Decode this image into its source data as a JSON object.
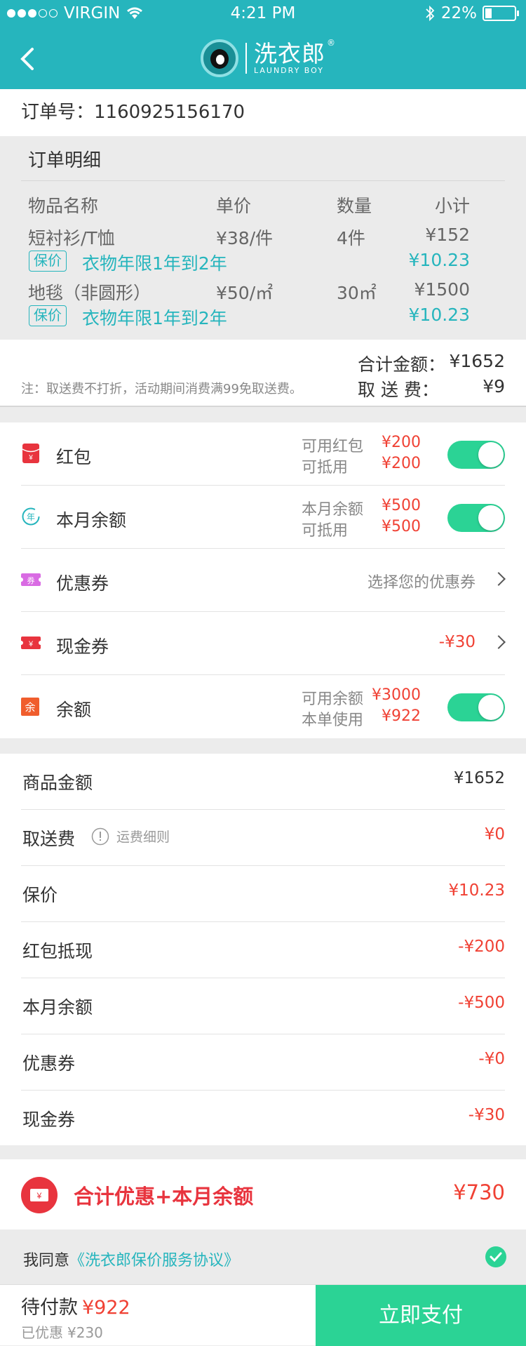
{
  "status_bar": {
    "carrier": "VIRGIN",
    "time": "4:21 PM",
    "battery": "22%"
  },
  "header": {
    "brand_cn": "洗衣郎",
    "brand_en": "LAUNDRY BOY",
    "brand_mark": "®"
  },
  "order": {
    "number_label": "订单号：",
    "number": "1160925156170"
  },
  "detail": {
    "title": "订单明细",
    "columns": [
      "物品名称",
      "单价",
      "数量",
      "小计"
    ],
    "items": [
      {
        "name": "短衬衫/T恤",
        "price": "¥38/件",
        "qty": "4件",
        "subtotal": "¥152",
        "tag": "保价",
        "tag_text": "衣物年限1年到2年",
        "insured": "¥10.23"
      },
      {
        "name": "地毯（非圆形）",
        "price": "¥50/㎡",
        "qty": "30㎡",
        "subtotal": "¥1500",
        "tag": "保价",
        "tag_text": "衣物年限1年到2年",
        "insured": "¥10.23"
      }
    ]
  },
  "totals": {
    "note": "注：取送费不打折，活动期间消费满99免取送费。",
    "sum_label": "合计金额：",
    "sum_value": "¥1652",
    "delivery_label": "取 送 费：",
    "delivery_value": "¥9"
  },
  "options": {
    "hongbao": {
      "label": "红包",
      "sub1": "可用红包",
      "val1": "¥200",
      "sub2": "可抵用",
      "val2": "¥200",
      "icon": "red-envelope-icon",
      "toggle": true
    },
    "monthly": {
      "label": "本月余额",
      "sub1": "本月余额",
      "val1": "¥500",
      "sub2": "可抵用",
      "val2": "¥500",
      "icon": "monthly-balance-icon",
      "toggle": true
    },
    "coupon": {
      "label": "优惠券",
      "placeholder": "选择您的优惠券",
      "icon": "coupon-icon"
    },
    "cash": {
      "label": "现金券",
      "value": "-¥30",
      "icon": "cash-coupon-icon"
    },
    "balance": {
      "label": "余额",
      "sub1": "可用余额",
      "val1": "¥3000",
      "sub2": "本单使用",
      "val2": "¥922",
      "icon": "balance-icon",
      "toggle": true
    }
  },
  "summary": {
    "goods_label": "商品金额",
    "goods_value": "¥1652",
    "delivery_label": "取送费",
    "delivery_rule": "运费细则",
    "delivery_value": "¥0",
    "insure_label": "保价",
    "insure_value": "¥10.23",
    "hongbao_label": "红包抵现",
    "hongbao_value": "-¥200",
    "monthly_label": "本月余额",
    "monthly_value": "-¥500",
    "coupon_label": "优惠券",
    "coupon_value": "-¥0",
    "cash_label": "现金券",
    "cash_value": "-¥30"
  },
  "combined": {
    "label": "合计优惠+本月余额",
    "value": "¥730",
    "icon_text": "¥"
  },
  "agreement": {
    "prefix": "我同意",
    "link": "《洗衣郎保价服务协议》",
    "checked": true
  },
  "bottom": {
    "due_label": "待付款",
    "due_value": "¥922",
    "saved_label": "已优惠",
    "saved_value": "¥230",
    "pay_label": "立即支付"
  },
  "colors": {
    "teal": "#26b5bd",
    "green": "#2bd395",
    "red": "#f04134"
  }
}
